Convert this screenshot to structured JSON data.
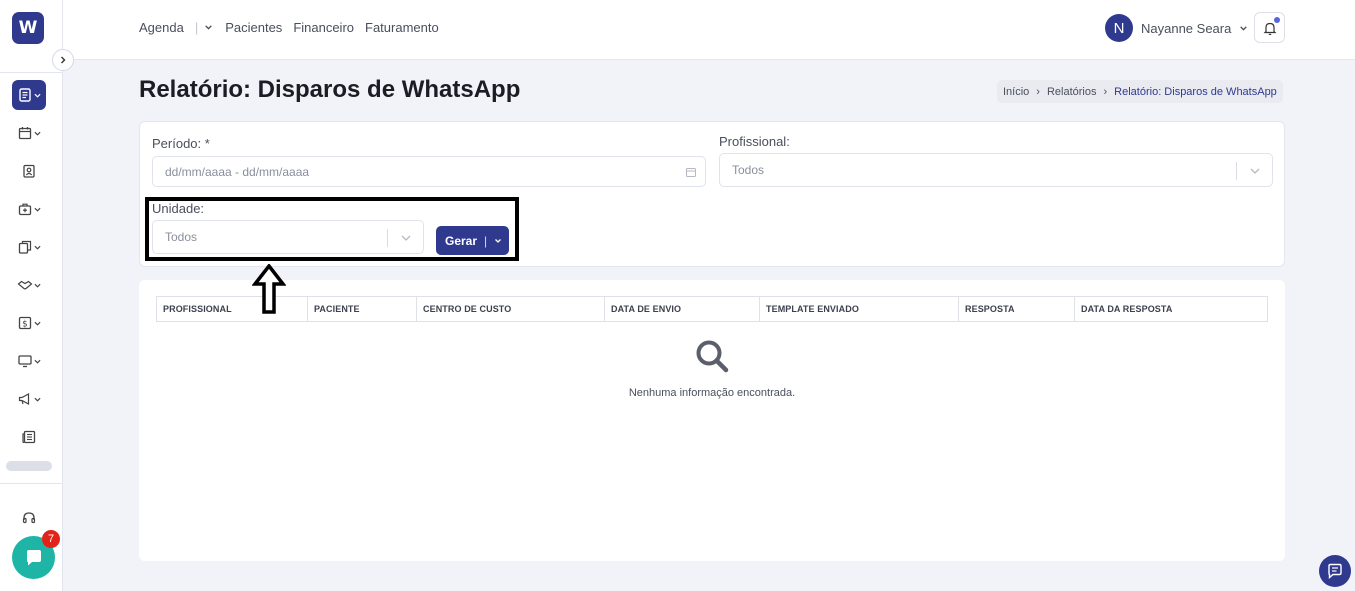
{
  "app": {
    "logo_letter": "W"
  },
  "topnav": {
    "items": [
      "Agenda",
      "Pacientes",
      "Financeiro",
      "Faturamento"
    ]
  },
  "user": {
    "initial": "N",
    "name": "Nayanne Seara"
  },
  "chat": {
    "badge_count": "7"
  },
  "page": {
    "title": "Relatório: Disparos de WhatsApp"
  },
  "breadcrumb": {
    "items": [
      "Início",
      "Relatórios",
      "Relatório: Disparos de WhatsApp"
    ]
  },
  "filters": {
    "periodo_label": "Período: *",
    "periodo_placeholder": "dd/mm/aaaa - dd/mm/aaaa",
    "profissional_label": "Profissional:",
    "profissional_value": "Todos",
    "unidade_label": "Unidade:",
    "unidade_value": "Todos",
    "gerar_label": "Gerar"
  },
  "table": {
    "columns": [
      "PROFISSIONAL",
      "PACIENTE",
      "CENTRO DE CUSTO",
      "DATA DE ENVIO",
      "TEMPLATE ENVIADO",
      "RESPOSTA",
      "DATA DA RESPOSTA"
    ],
    "empty_message": "Nenhuma informação encontrada."
  },
  "sidebar": {
    "icons": [
      "report-icon",
      "calendar-icon",
      "patient-badge-icon",
      "medical-bag-icon",
      "documents-icon",
      "handshake-icon",
      "money-icon",
      "monitor-icon",
      "megaphone-icon",
      "newspaper-icon",
      "headset-icon"
    ]
  },
  "colors": {
    "primary": "#2f3a8f",
    "chat": "#1fb5a6",
    "badge": "#e2231a"
  }
}
